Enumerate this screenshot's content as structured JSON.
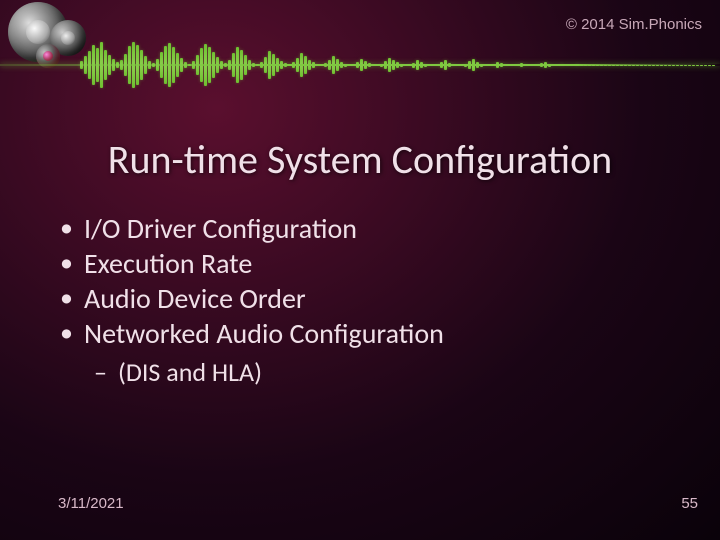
{
  "copyright": "© 2014 Sim.Phonics",
  "title": "Run-time System Configuration",
  "bullets": [
    "I/O Driver Configuration",
    "Execution Rate",
    "Audio Device Order",
    "Networked Audio Configuration"
  ],
  "sub_bullet": "(DIS and HLA)",
  "footer": {
    "date": "3/11/2021",
    "page": "55"
  }
}
